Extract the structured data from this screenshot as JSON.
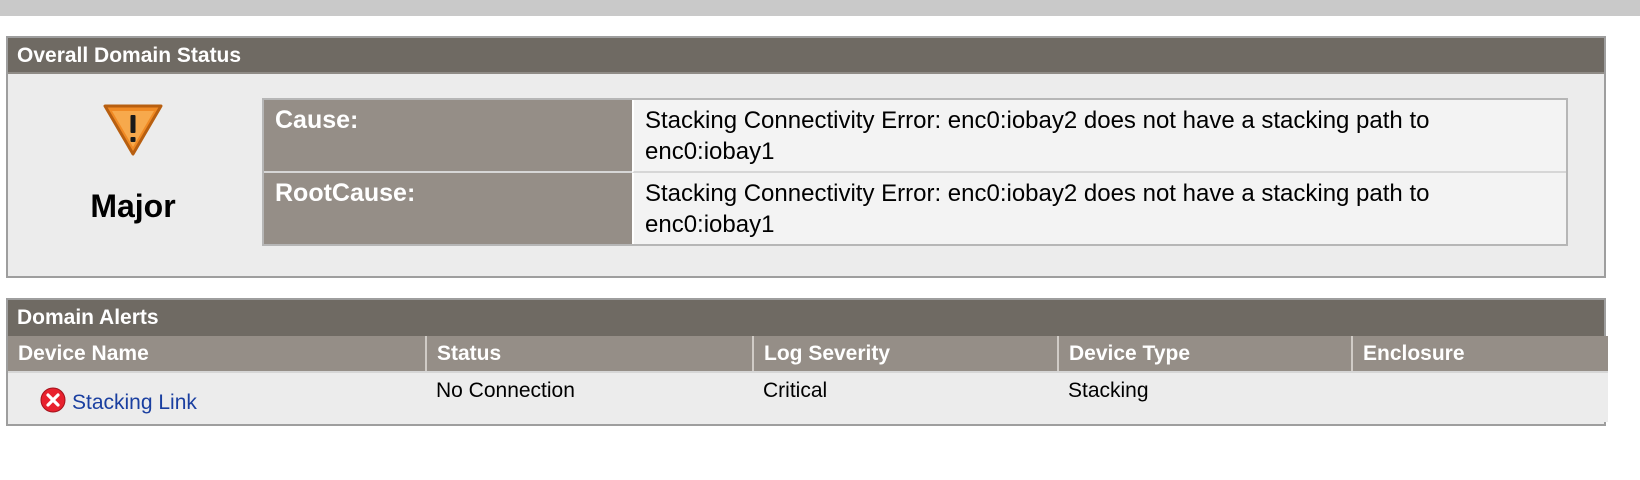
{
  "overall_status": {
    "title": "Overall Domain Status",
    "severity": "Major",
    "severity_icon": "warning-triangle-icon",
    "rows": [
      {
        "label": "Cause:",
        "value": "Stacking Connectivity Error: enc0:iobay2 does not have a stacking path to enc0:iobay1"
      },
      {
        "label": "RootCause:",
        "value": "Stacking Connectivity Error: enc0:iobay2 does not have a stacking path to enc0:iobay1"
      }
    ]
  },
  "domain_alerts": {
    "title": "Domain Alerts",
    "columns": [
      "Device Name",
      "Status",
      "Log Severity",
      "Device Type",
      "Enclosure"
    ],
    "rows": [
      {
        "device_name": "Stacking Link",
        "status": "No Connection",
        "log_severity": "Critical",
        "device_type": "Stacking",
        "enclosure": "",
        "icon": "error-x-icon"
      }
    ]
  },
  "colors": {
    "header_dark": "#6f6a63",
    "header_light": "#958e87",
    "panel_bg": "#ececec",
    "warning_orange": "#f08a24",
    "error_red": "#e8212e",
    "link_blue": "#1a3fa0"
  }
}
